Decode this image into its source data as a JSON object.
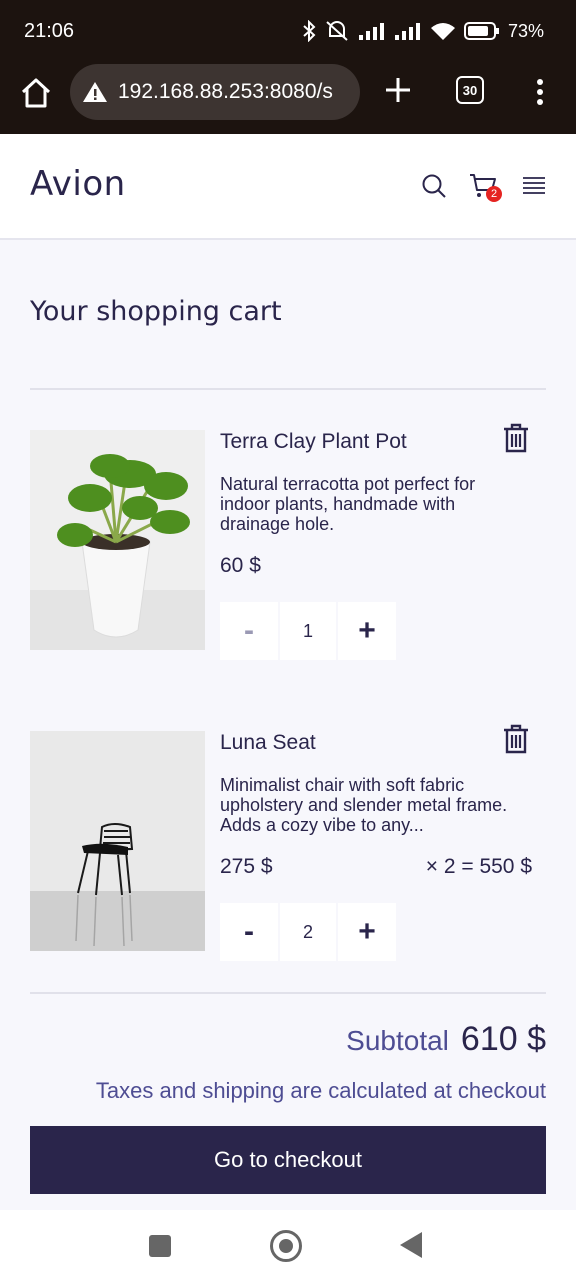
{
  "status_bar": {
    "time": "21:06",
    "battery": "73"
  },
  "browser": {
    "url": "192.168.88.253:8080/s",
    "tab_count": "30"
  },
  "header": {
    "logo": "Avion",
    "cart_count": "2"
  },
  "page": {
    "title": "Your shopping cart"
  },
  "cart_items": [
    {
      "name": "Terra Clay Plant Pot",
      "description": "Natural terracotta pot perfect for indoor plants, handmade with drainage hole.",
      "price": "60 $",
      "line_total": "",
      "quantity": "1",
      "minus": "-",
      "plus": "+"
    },
    {
      "name": "Luna Seat",
      "description": "Minimalist chair with soft fabric upholstery and slender metal frame. Adds a cozy vibe to any...",
      "price": "275 $",
      "line_total": "× 2 = 550 $",
      "quantity": "2",
      "minus": "-",
      "plus": "+"
    }
  ],
  "summary": {
    "subtotal_label": "Subtotal",
    "subtotal_value": "610 $",
    "tax_note": "Taxes and shipping are calculated at checkout",
    "checkout_label": "Go to checkout"
  }
}
